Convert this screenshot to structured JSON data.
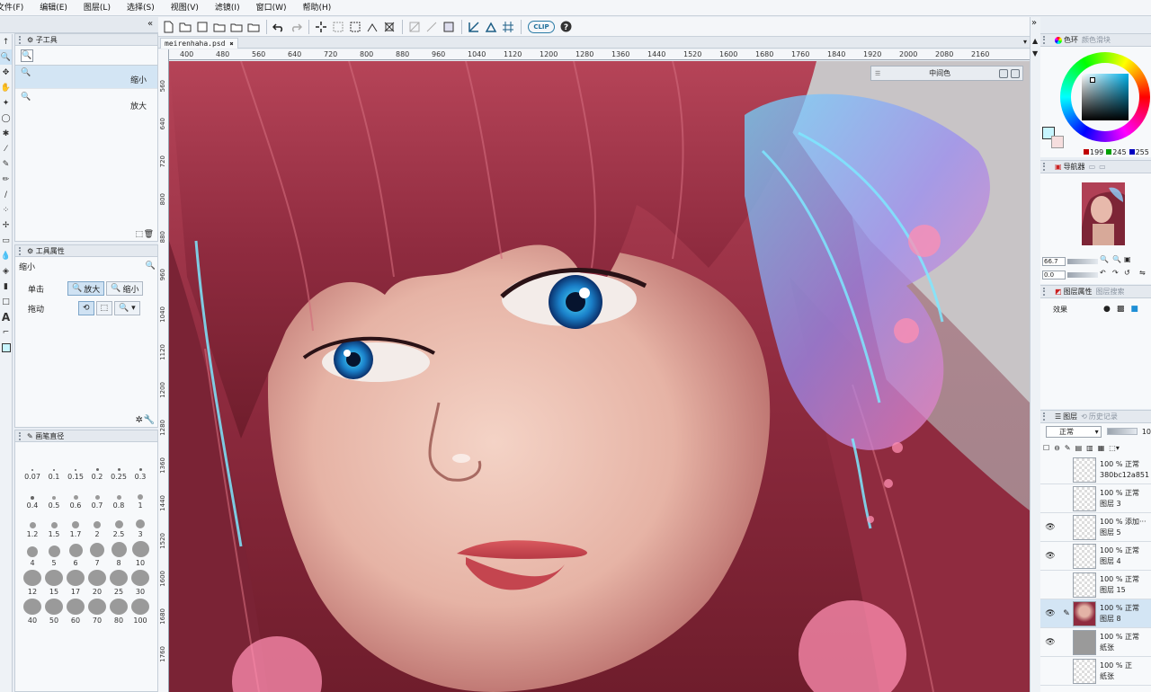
{
  "menu": [
    "文件(F)",
    "编辑(E)",
    "图层(L)",
    "选择(S)",
    "视图(V)",
    "滤镜(I)",
    "窗口(W)",
    "帮助(H)"
  ],
  "toolbar": {
    "clip_label": "CLIP",
    "help_icon": "help-icon"
  },
  "document": {
    "tab_name": "meirenhaha.psd",
    "close_glyph": "✖"
  },
  "ruler": {
    "top": [
      "400",
      "480",
      "560",
      "640",
      "720",
      "800",
      "880",
      "960",
      "1040",
      "1120",
      "1200",
      "1280",
      "1360",
      "1440",
      "1520",
      "1600",
      "1680",
      "1760",
      "1840",
      "1920",
      "2000",
      "2080",
      "2160"
    ],
    "left": [
      "560",
      "640",
      "720",
      "800",
      "880",
      "960",
      "1040",
      "1120",
      "1200",
      "1280",
      "1360",
      "1440",
      "1520",
      "1600",
      "1680",
      "1760"
    ]
  },
  "subtool": {
    "title": "子工具",
    "items": [
      {
        "label": "缩小"
      },
      {
        "label": "放大"
      }
    ]
  },
  "tool_property": {
    "title": "工具属性",
    "tool_name": "缩小",
    "click_label": "单击",
    "zoom_in": "放大",
    "zoom_out": "缩小",
    "drag_label": "拖动"
  },
  "brush_size": {
    "title": "画笔直径",
    "sizes": [
      "0.07",
      "0.1",
      "0.15",
      "0.2",
      "0.25",
      "0.3",
      "0.4",
      "0.5",
      "0.6",
      "0.7",
      "0.8",
      "1",
      "1.2",
      "1.5",
      "1.7",
      "2",
      "2.5",
      "3",
      "4",
      "5",
      "6",
      "7",
      "8",
      "10",
      "12",
      "15",
      "17",
      "20",
      "25",
      "30",
      "40",
      "50",
      "60",
      "70",
      "80",
      "100"
    ]
  },
  "mid_color": {
    "title": "中间色"
  },
  "color_panel": {
    "tab_active": "色环",
    "tab_inactive": "颜色滑块",
    "r": "199",
    "g": "245",
    "b": "255",
    "r_swatch": "#c00000",
    "g_swatch": "#00a000",
    "b_swatch": "#0000c0",
    "current_color": "#c7f5ff"
  },
  "navigator": {
    "tab_active": "导航器",
    "zoom": "66.7",
    "rotate": "0.0"
  },
  "layer_property": {
    "tab_active": "图层属性",
    "tab_inactive": "图层搜索",
    "effect_label": "效果"
  },
  "layers": {
    "tab_active": "图层",
    "tab_inactive": "历史记录",
    "blend_mode": "正常",
    "opacity_fragment": "10",
    "rows": [
      {
        "line1": "100 % 正常",
        "line2": "380bc12a851",
        "visible": false,
        "selected": false,
        "pen": false
      },
      {
        "line1": "100 % 正常",
        "line2": "图层 3",
        "visible": false,
        "selected": false,
        "pen": false
      },
      {
        "line1": "100 % 添加···",
        "line2": "图层 5",
        "visible": true,
        "selected": false,
        "pen": false
      },
      {
        "line1": "100 % 正常",
        "line2": "图层 4",
        "visible": true,
        "selected": false,
        "pen": false
      },
      {
        "line1": "100 % 正常",
        "line2": "图层 15",
        "visible": false,
        "selected": false,
        "pen": false
      },
      {
        "line1": "100 % 正常",
        "line2": "图层 8",
        "visible": true,
        "selected": true,
        "pen": true
      },
      {
        "line1": "100 % 正常",
        "line2": "纸张",
        "visible": true,
        "selected": false,
        "pen": false
      },
      {
        "line1": "100 % 正",
        "line2": "纸张",
        "visible": false,
        "selected": false,
        "pen": false
      }
    ]
  }
}
